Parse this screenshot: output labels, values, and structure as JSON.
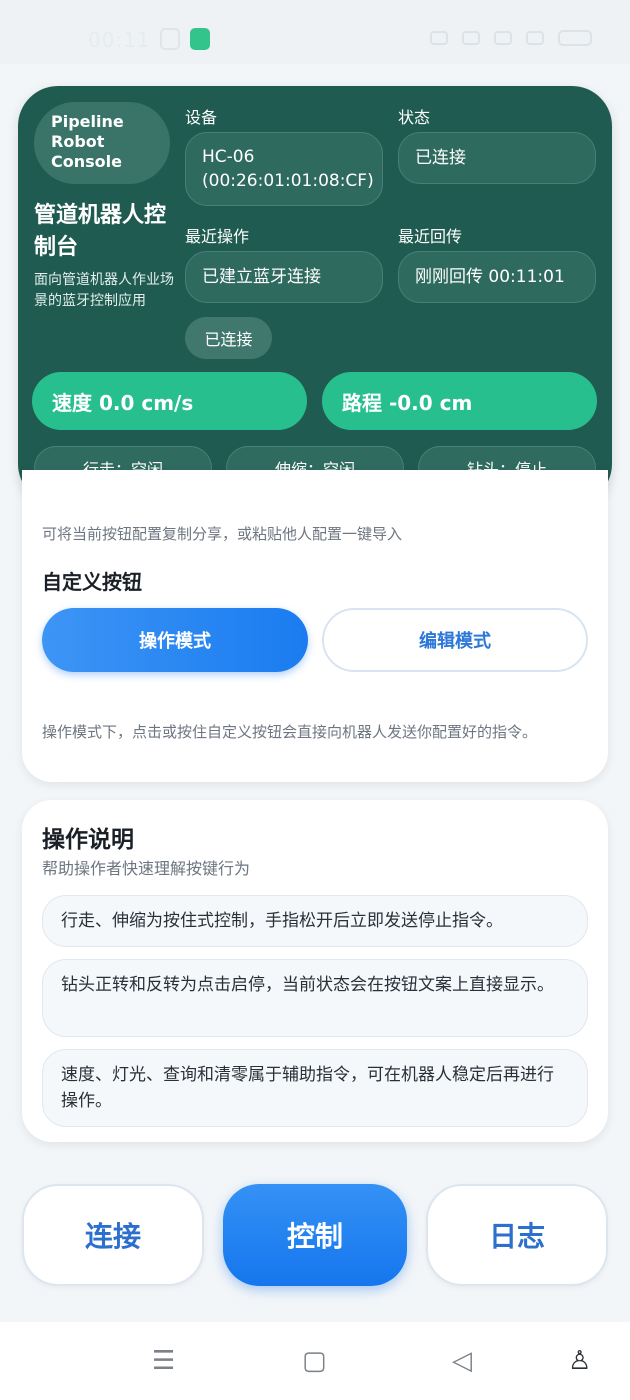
{
  "status_bar": {
    "time": "00:11"
  },
  "header": {
    "logo_text": "Pipeline\nRobot\nConsole",
    "app_title": "管道机器人控制台",
    "app_desc": "面向管道机器人作业场景的蓝牙控制应用",
    "device_label": "设备",
    "device_value": "HC-06 (00:26:01:01:08:CF)",
    "state_label": "状态",
    "state_value": "已连接",
    "last_op_label": "最近操作",
    "last_op_value": "已建立蓝牙连接",
    "last_return_label": "最近回传",
    "last_return_value": "刚刚回传 00:11:01",
    "connected_pill": "已连接",
    "speed": "速度 0.0 cm/s",
    "distance": "路程 -0.0 cm",
    "chips": [
      "行走：空闲",
      "伸缩：空闲",
      "钻头：停止"
    ]
  },
  "custom_buttons": {
    "share_hint": "可将当前按钮配置复制分享，或粘贴他人配置一键导入",
    "title": "自定义按钮",
    "operate_mode": "操作模式",
    "edit_mode": "编辑模式",
    "mode_hint": "操作模式下，点击或按住自定义按钮会直接向机器人发送你配置好的指令。"
  },
  "instructions": {
    "title": "操作说明",
    "subtitle": "帮助操作者快速理解按键行为",
    "items": [
      "行走、伸缩为按住式控制，手指松开后立即发送停止指令。",
      "钻头正转和反转为点击启停，当前状态会在按钮文案上直接显示。",
      "速度、灯光、查询和清零属于辅助指令，可在机器人稳定后再进行操作。"
    ]
  },
  "bottom_nav": {
    "connect": "连接",
    "control": "控制",
    "log": "日志",
    "active": "control"
  },
  "system_nav": {
    "icons": [
      "menu-icon",
      "home-icon",
      "back-icon",
      "accessibility-icon"
    ]
  },
  "colors": {
    "header_bg": "#1f5b50",
    "accent_green": "#28bf8e",
    "accent_blue": "#1a7cf0"
  }
}
